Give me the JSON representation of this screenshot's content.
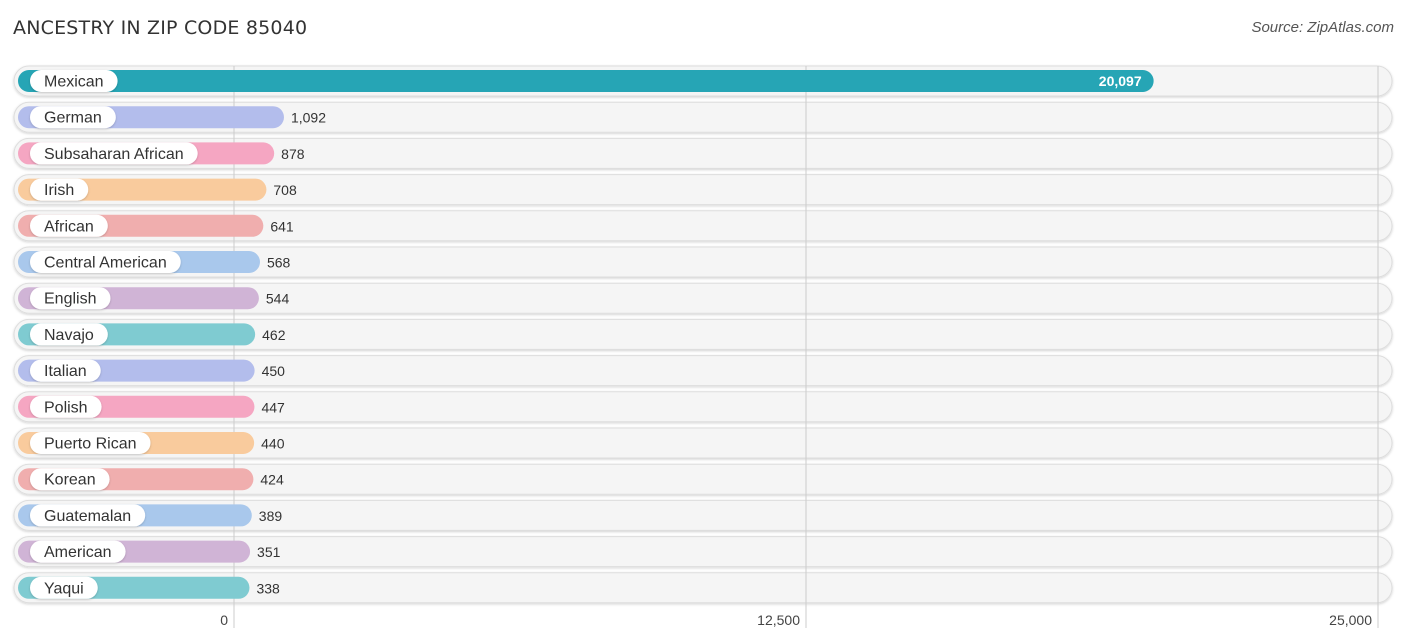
{
  "header": {
    "title": "ANCESTRY IN ZIP CODE 85040",
    "source": "Source: ZipAtlas.com"
  },
  "chart_data": {
    "type": "bar",
    "orientation": "horizontal",
    "title": "ANCESTRY IN ZIP CODE 85040",
    "source": "Source: ZipAtlas.com",
    "xlabel": "",
    "ylabel": "",
    "xlim": [
      0,
      25000
    ],
    "ticks": [
      0,
      12500,
      25000
    ],
    "tick_labels": [
      "0",
      "12,500",
      "25,000"
    ],
    "grid": true,
    "categories": [
      "Mexican",
      "German",
      "Subsaharan African",
      "Irish",
      "African",
      "Central American",
      "English",
      "Navajo",
      "Italian",
      "Polish",
      "Puerto Rican",
      "Korean",
      "Guatemalan",
      "American",
      "Yaqui"
    ],
    "values": [
      20097,
      1092,
      878,
      708,
      641,
      568,
      544,
      462,
      450,
      447,
      440,
      424,
      389,
      351,
      338
    ],
    "value_labels": [
      "20,097",
      "1,092",
      "878",
      "708",
      "641",
      "568",
      "544",
      "462",
      "450",
      "447",
      "440",
      "424",
      "389",
      "351",
      "338"
    ],
    "colors": [
      "#26a5b5",
      "#b3bdec",
      "#f5a6c2",
      "#f9cb9d",
      "#f0aeae",
      "#a9c8ec",
      "#d0b4d6",
      "#7fcbd1",
      "#b3bdec",
      "#f5a6c2",
      "#f9cb9d",
      "#f0aeae",
      "#a9c8ec",
      "#d0b4d6",
      "#7fcbd1"
    ]
  }
}
